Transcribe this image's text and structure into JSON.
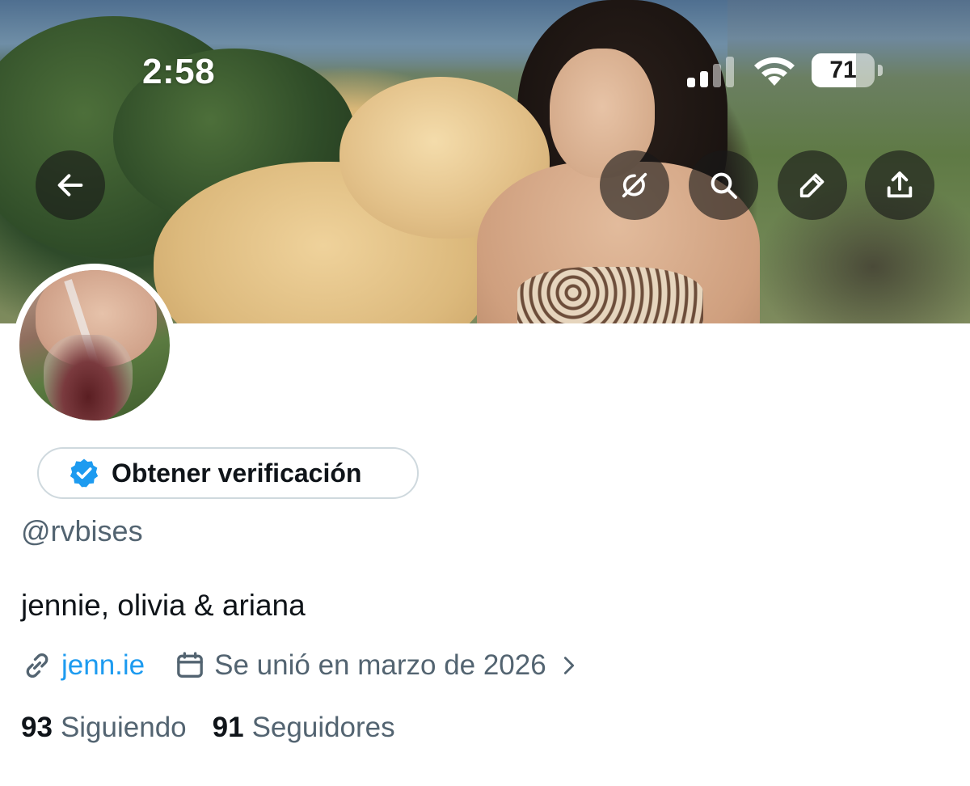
{
  "status_bar": {
    "time": "2:58",
    "battery_level": "71",
    "battery_fraction": 0.71,
    "icons": [
      "signal-icon",
      "wifi-icon",
      "battery-icon"
    ]
  },
  "header_actions": {
    "back_icon": "arrow-left-icon",
    "icons": [
      "grok-icon",
      "search-icon",
      "edit-pencil-icon",
      "share-upload-icon"
    ]
  },
  "profile": {
    "verify_button_label": "Obtener verificación",
    "verify_icon": "verified-badge-icon",
    "handle": "@rvbises",
    "bio": "jennie, olivia & ariana",
    "link_icon": "link-icon",
    "website": "jenn.ie",
    "calendar_icon": "calendar-icon",
    "joined": "Se unió en marzo de 2026",
    "chevron_icon": "chevron-right-icon"
  },
  "stats": {
    "following_count": "93",
    "following_label": "Siguiendo",
    "followers_count": "91",
    "followers_label": "Seguidores"
  },
  "colors": {
    "accent": "#1d9bf0",
    "text_primary": "#0f1419",
    "text_secondary": "#536471",
    "border": "#cfd9de"
  }
}
